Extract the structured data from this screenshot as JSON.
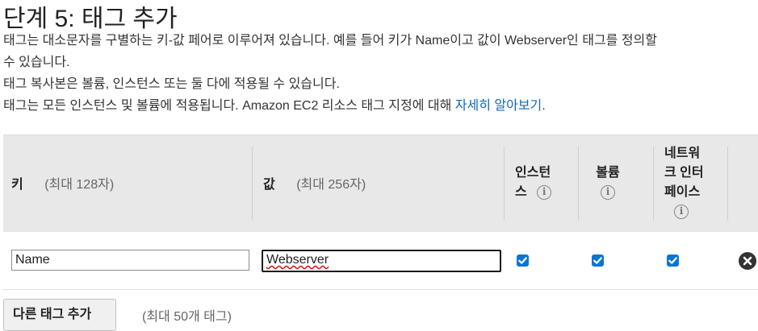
{
  "title": "단계 5: 태그 추가",
  "description": {
    "line1": "태그는 대소문자를 구별하는 키-값 페어로 이루어져 있습니다. 예를 들어 키가 Name이고 값이 Webserver인 태그를 정의할",
    "line2": "수 있습니다.",
    "line3": "태그 복사본은 볼륨, 인스턴스 또는 둘 다에 적용될 수 있습니다.",
    "line4_text": "태그는 모든 인스턴스 및 볼륨에 적용됩니다. Amazon EC2 리소스 태그 지정에 대해 ",
    "line4_link": "자세히 알아보기",
    "line4_end": "."
  },
  "table": {
    "headers": {
      "key_label": "키",
      "key_hint": "(최대 128자)",
      "value_label": "값",
      "value_hint": "(최대 256자)",
      "instances_line1": "인스턴",
      "instances_line2": "스",
      "volumes_label": "볼륨",
      "eni_line1": "네트워",
      "eni_line2": "크 인터",
      "eni_line3": "페이스"
    },
    "rows": [
      {
        "key": "Name",
        "value": "Webserver",
        "instances": true,
        "volumes": true,
        "network_interfaces": true
      }
    ]
  },
  "add_button_label": "다른 태그 추가",
  "limit_text": "(최대 50개 태그)",
  "icons": [
    "info-icon",
    "checkmark-icon",
    "remove-icon"
  ],
  "colors": {
    "checkbox": "#0b75d4",
    "link": "#1166bb",
    "header_bg": "#e8e8e8"
  }
}
